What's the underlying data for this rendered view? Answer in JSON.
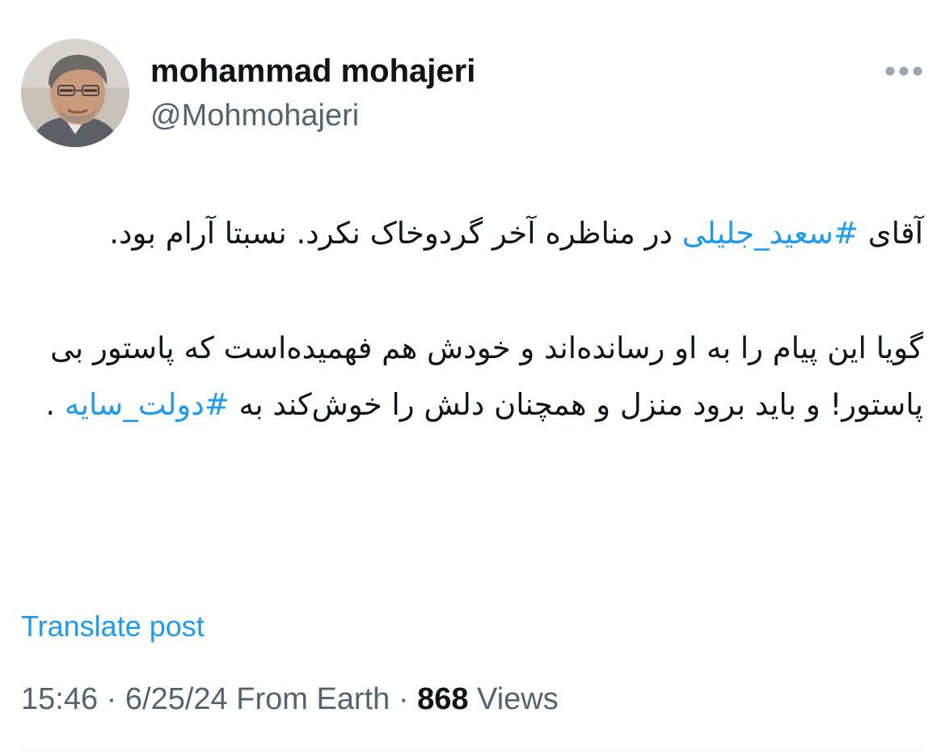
{
  "author": {
    "display_name": "mohammad mohajeri",
    "handle": "@Mohmohajeri"
  },
  "tweet": {
    "paragraph_1": [
      {
        "text": "آقای ",
        "hashtag": false
      },
      {
        "text": "#سعید_جلیلی",
        "hashtag": true
      },
      {
        "text": "  در مناظره آخر گردوخاک نکرد. نسبتا آرام بود.",
        "hashtag": false
      }
    ],
    "paragraph_2": [
      {
        "text": "گویا این پیام را به او رسانده‌اند و خودش هم فهمیده‌است که پاستور بی پاستور! و باید برود منزل و همچنان دلش را خوش‌کند به  ",
        "hashtag": false
      },
      {
        "text": "#دولت_سایه",
        "hashtag": true
      },
      {
        "text": " .",
        "hashtag": false
      }
    ]
  },
  "translate_label": "Translate post",
  "meta": {
    "time": "15:46",
    "separator": " · ",
    "date": "6/25/24",
    "source": "From Earth",
    "views_count": "868",
    "views_label": "Views"
  },
  "icons": {
    "more": "more-horizontal-icon",
    "avatar": "profile-photo"
  },
  "colors": {
    "text": "#0f1419",
    "secondary": "#536471",
    "accent": "#1d9bf0",
    "divider": "#eff3f4"
  }
}
